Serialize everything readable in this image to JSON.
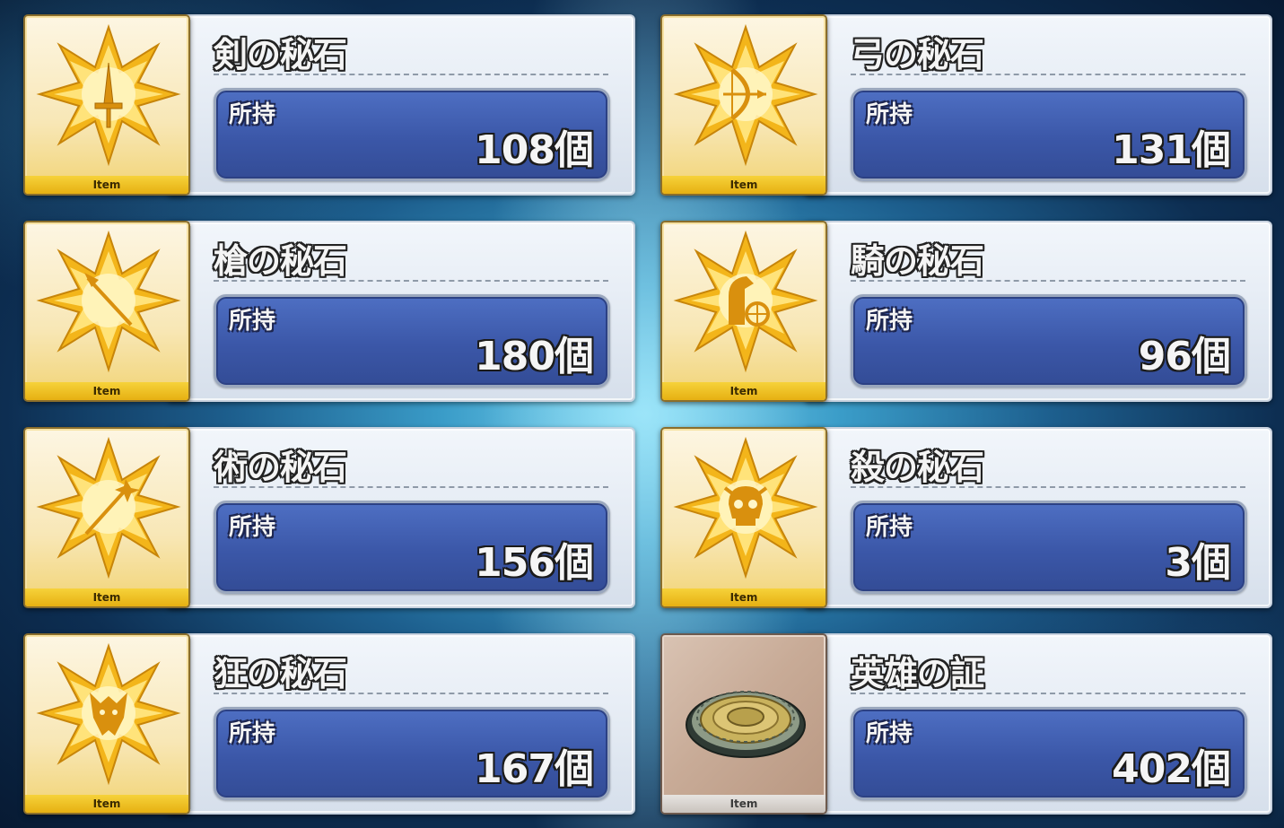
{
  "items": [
    {
      "name": "剣の秘石",
      "owned_label": "所持",
      "count": "108個",
      "badge": "Item",
      "symbol": "sword-icon"
    },
    {
      "name": "弓の秘石",
      "owned_label": "所持",
      "count": "131個",
      "badge": "Item",
      "symbol": "bow-icon"
    },
    {
      "name": "槍の秘石",
      "owned_label": "所持",
      "count": "180個",
      "badge": "Item",
      "symbol": "spear-icon"
    },
    {
      "name": "騎の秘石",
      "owned_label": "所持",
      "count": "96個",
      "badge": "Item",
      "symbol": "horse-icon"
    },
    {
      "name": "術の秘石",
      "owned_label": "所持",
      "count": "156個",
      "badge": "Item",
      "symbol": "staff-icon"
    },
    {
      "name": "殺の秘石",
      "owned_label": "所持",
      "count": "3個",
      "badge": "Item",
      "symbol": "skull-icon"
    },
    {
      "name": "狂の秘石",
      "owned_label": "所持",
      "count": "167個",
      "badge": "Item",
      "symbol": "beast-icon"
    },
    {
      "name": "英雄の証",
      "owned_label": "所持",
      "count": "402個",
      "badge": "Item",
      "symbol": "medallion-icon"
    }
  ],
  "colors": {
    "gem_gold": "#f3b51a",
    "count_box": "#3b57a8",
    "panel": "#e3eaf3"
  }
}
